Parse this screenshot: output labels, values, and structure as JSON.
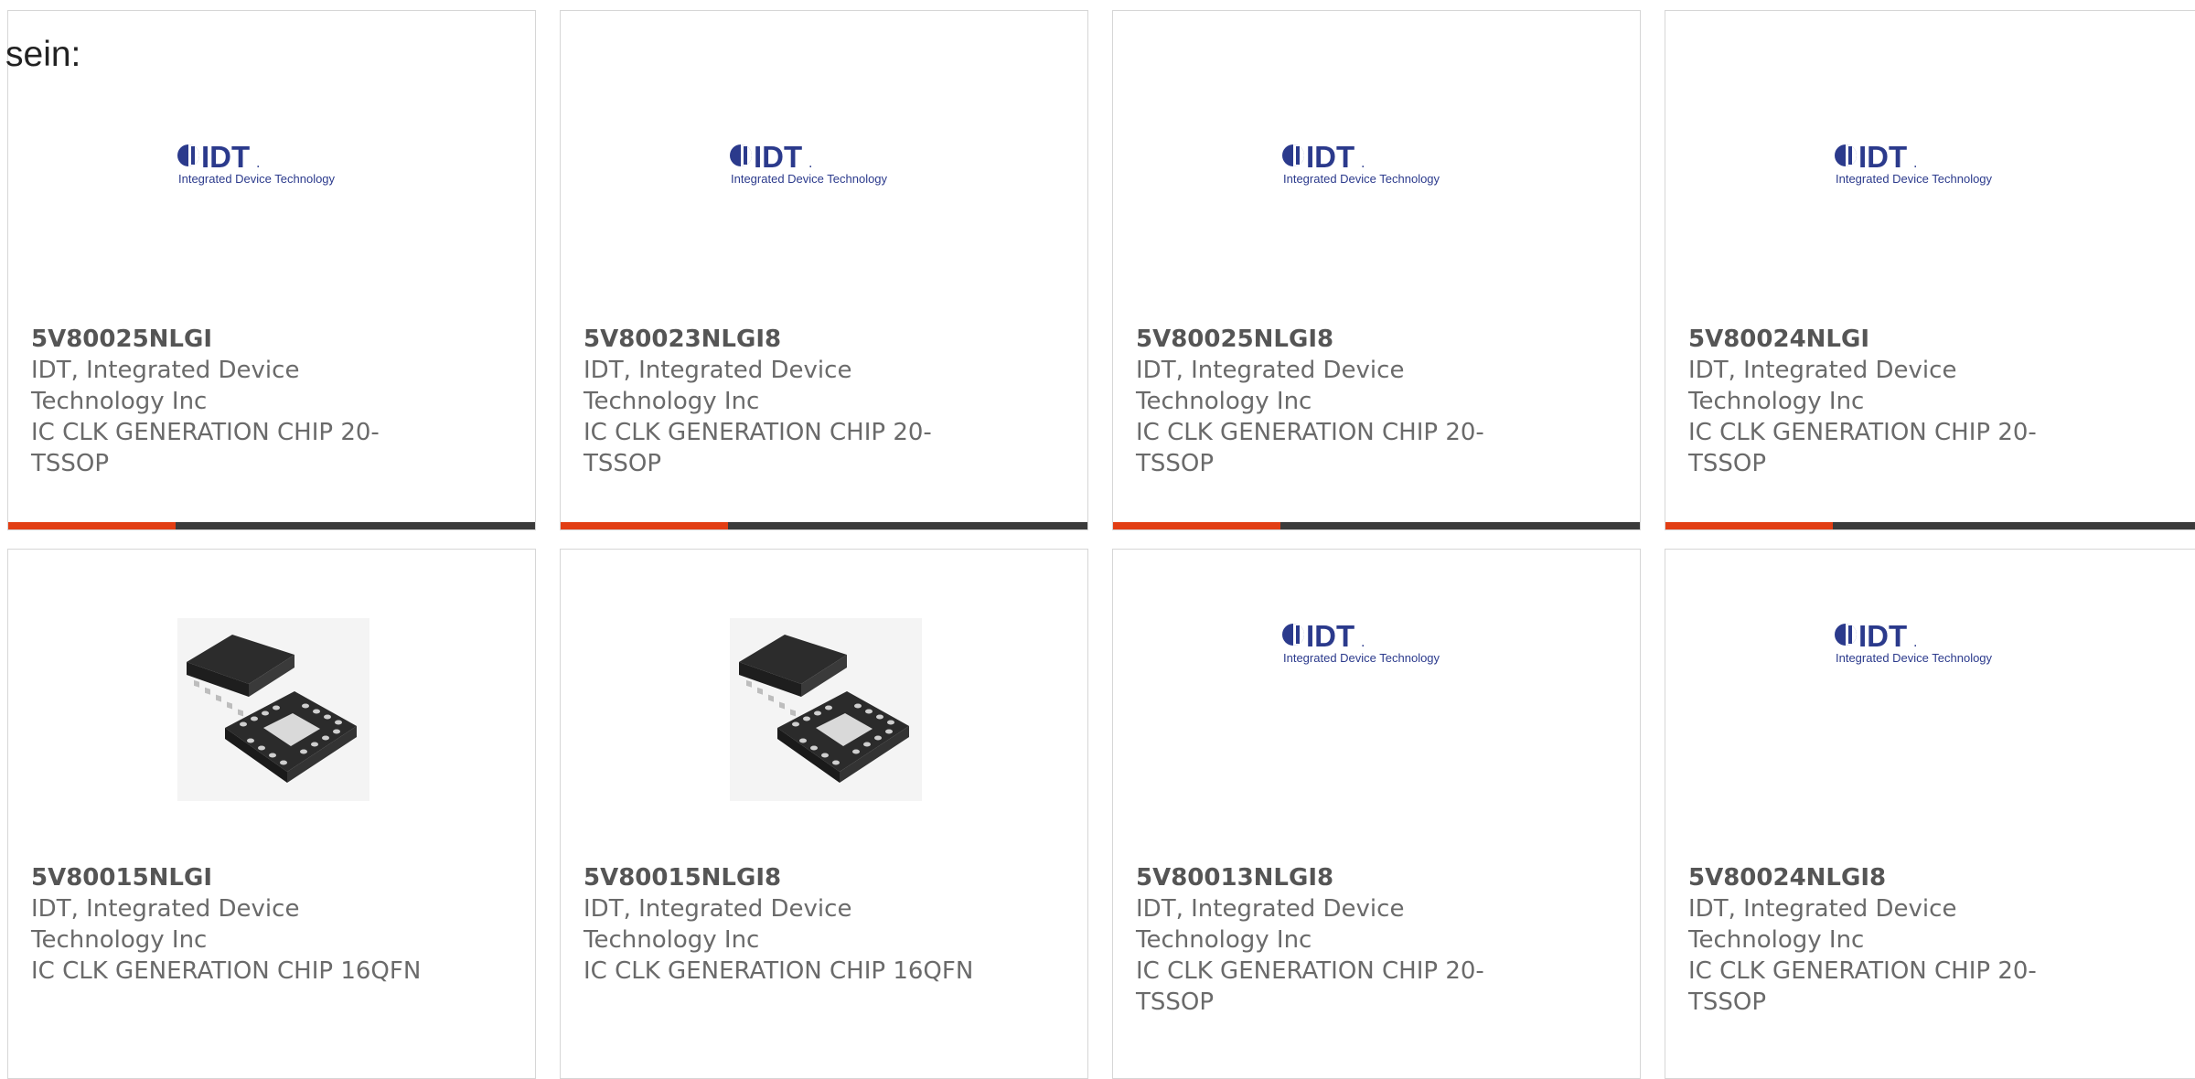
{
  "intro_text": "sein:",
  "colors": {
    "accent": "#e23e14",
    "bar_dark": "#3b3b3b",
    "logo_blue": "#2b3a8c"
  },
  "logo": {
    "brand": "IDT",
    "tagline": "Integrated Device Technology"
  },
  "products": [
    {
      "part_number": "5V80025NLGI",
      "manufacturer": "IDT, Integrated Device Technology Inc",
      "description": "IC CLK GENERATION CHIP 20-TSSOP",
      "image": "idt-logo"
    },
    {
      "part_number": "5V80023NLGI8",
      "manufacturer": "IDT, Integrated Device Technology Inc",
      "description": "IC CLK GENERATION CHIP 20-TSSOP",
      "image": "idt-logo"
    },
    {
      "part_number": "5V80025NLGI8",
      "manufacturer": "IDT, Integrated Device Technology Inc",
      "description": "IC CLK GENERATION CHIP 20-TSSOP",
      "image": "idt-logo"
    },
    {
      "part_number": "5V80024NLGI",
      "manufacturer": "IDT, Integrated Device Technology Inc",
      "description": "IC CLK GENERATION CHIP 20-TSSOP",
      "image": "idt-logo"
    },
    {
      "part_number": "5V80015NLGI",
      "manufacturer": "IDT, Integrated Device Technology Inc",
      "description": "IC CLK GENERATION CHIP 16QFN",
      "image": "qfn-chip-photo"
    },
    {
      "part_number": "5V80015NLGI8",
      "manufacturer": "IDT, Integrated Device Technology Inc",
      "description": "IC CLK GENERATION CHIP 16QFN",
      "image": "qfn-chip-photo"
    },
    {
      "part_number": "5V80013NLGI8",
      "manufacturer": "IDT, Integrated Device Technology Inc",
      "description": "IC CLK GENERATION CHIP 20-TSSOP",
      "image": "idt-logo"
    },
    {
      "part_number": "5V80024NLGI8",
      "manufacturer": "IDT, Integrated Device Technology Inc",
      "description": "IC CLK GENERATION CHIP 20-TSSOP",
      "image": "idt-logo"
    }
  ]
}
